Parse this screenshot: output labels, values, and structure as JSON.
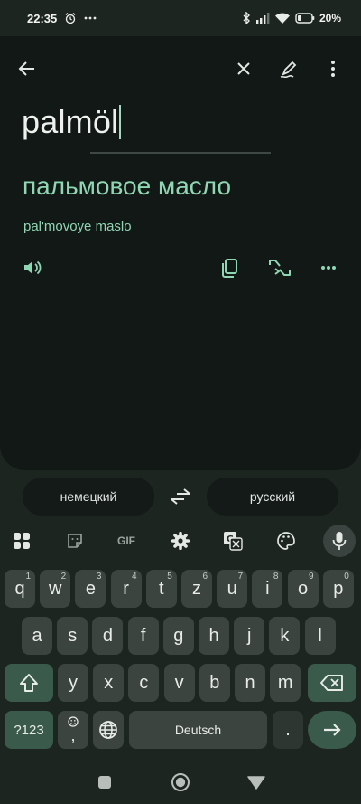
{
  "status_bar": {
    "time": "22:35",
    "battery": "20%"
  },
  "translator": {
    "source_text": "palmöl",
    "translation": "пальмовое масло",
    "transliteration": "pal'movoye maslo"
  },
  "languages": {
    "source": "немецкий",
    "target": "русский"
  },
  "keyboard": {
    "toolbar": [
      "apps-grid-icon",
      "sticker-icon",
      "gif-icon",
      "settings-icon",
      "translate-icon",
      "palette-icon",
      "mic-icon"
    ],
    "gif_label": "GIF",
    "row1": [
      {
        "k": "q",
        "h": "1"
      },
      {
        "k": "w",
        "h": "2"
      },
      {
        "k": "e",
        "h": "3"
      },
      {
        "k": "r",
        "h": "4"
      },
      {
        "k": "t",
        "h": "5"
      },
      {
        "k": "z",
        "h": "6"
      },
      {
        "k": "u",
        "h": "7"
      },
      {
        "k": "i",
        "h": "8"
      },
      {
        "k": "o",
        "h": "9"
      },
      {
        "k": "p",
        "h": "0"
      }
    ],
    "row2": [
      "a",
      "s",
      "d",
      "f",
      "g",
      "h",
      "j",
      "k",
      "l"
    ],
    "row3": [
      "y",
      "x",
      "c",
      "v",
      "b",
      "n",
      "m"
    ],
    "symbols_label": "?123",
    "comma_label": ",",
    "space_label": "Deutsch",
    "period_label": "."
  },
  "colors": {
    "accent": "#8fd6b3",
    "panel": "#121815",
    "background": "#1d2521",
    "key": "#3c4440",
    "modifier_key": "#3a5a4b"
  }
}
